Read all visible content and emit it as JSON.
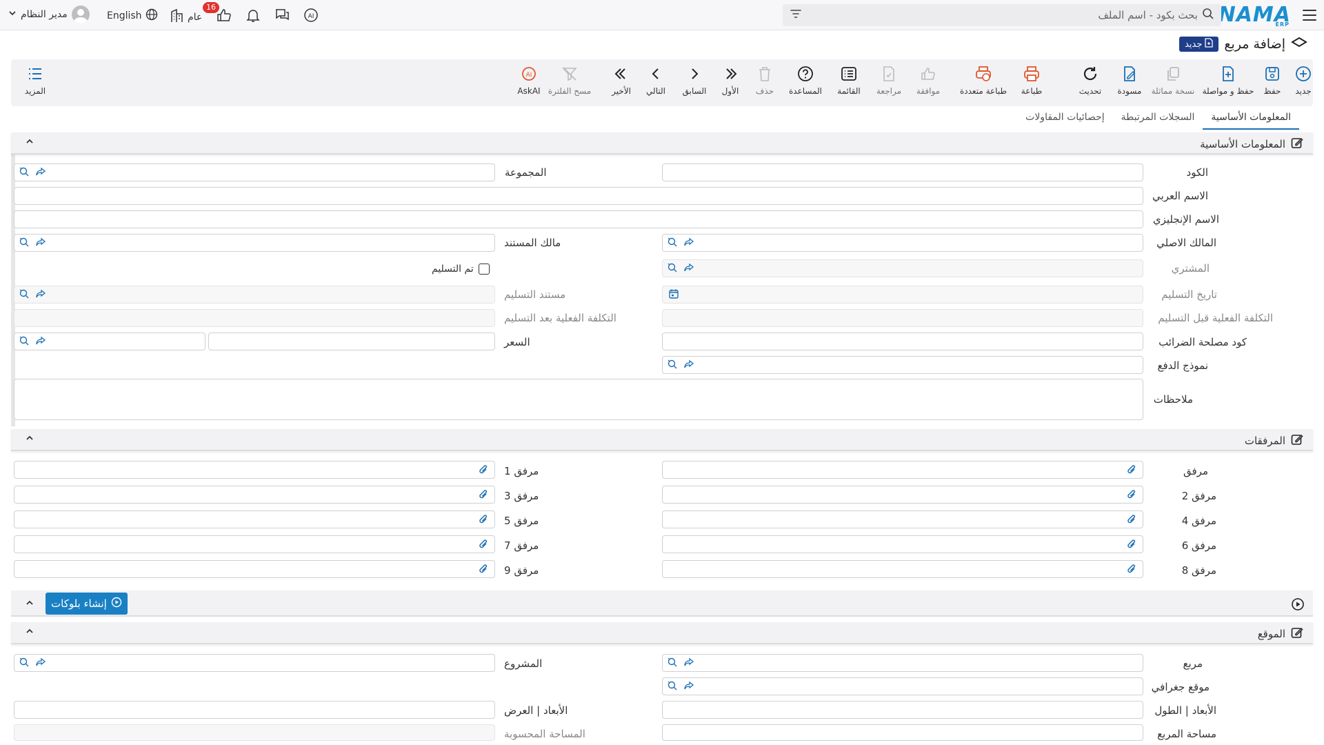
{
  "topbar": {
    "logo": "NAMA",
    "logo_sub": "ERP",
    "search_placeholder": "بحث بكود - اسم الملف",
    "language": "English",
    "general_label": "عام",
    "notif_count": "16",
    "user_name": "مدير النظام"
  },
  "page": {
    "title": "إضافة مربع",
    "new_badge": "جديد"
  },
  "toolbar": [
    {
      "label": "جديد",
      "icon": "plus-circle-icon"
    },
    {
      "label": "حفظ",
      "icon": "save-icon"
    },
    {
      "label": "حفظ و مواصلة",
      "icon": "save-continue-icon"
    },
    {
      "label": "نسخة مماثلة",
      "icon": "copy-icon"
    },
    {
      "label": "مسودة",
      "icon": "draft-icon"
    },
    {
      "label": "تحديث",
      "icon": "refresh-icon"
    },
    {
      "label": "طباعة",
      "icon": "print-icon"
    },
    {
      "label": "طباعة متعددة",
      "icon": "multi-print-icon"
    },
    {
      "label": "موافقة",
      "icon": "thumbs-up-icon"
    },
    {
      "label": "مراجعة",
      "icon": "review-icon"
    },
    {
      "label": "القائمة",
      "icon": "list-icon"
    },
    {
      "label": "المساعدة",
      "icon": "help-icon"
    },
    {
      "label": "حذف",
      "icon": "trash-icon"
    },
    {
      "label": "الأول",
      "icon": "first-icon"
    },
    {
      "label": "السابق",
      "icon": "prev-icon"
    },
    {
      "label": "التالي",
      "icon": "next-icon"
    },
    {
      "label": "الأخير",
      "icon": "last-icon"
    },
    {
      "label": "مسح الفلترة",
      "icon": "clear-filter-icon"
    },
    {
      "label": "AskAI",
      "icon": "ai-icon"
    },
    {
      "label": "المزيد",
      "icon": "more-icon"
    }
  ],
  "tabs": [
    "المعلومات الأساسية",
    "السجلات المرتبطة",
    "إحصائيات المقاولات"
  ],
  "sections": {
    "basic": "المعلومات الأساسية",
    "attachments": "المرفقات",
    "blocks_button": "إنشاء بلوكات",
    "location": "الموقع"
  },
  "basic_fields": {
    "code": "الكود",
    "group": "المجموعة",
    "arabic_name": "الاسم العربي",
    "english_name": "الاسم الإنجليزي",
    "original_owner": "المالك الاصلي",
    "document_owner": "مالك المستند",
    "buyer": "المشتري",
    "delivered": "تم التسليم",
    "delivery_date": "تاريخ التسليم",
    "delivery_document": "مستند التسليم",
    "cost_before": "التكلفة الفعلية قبل التسليم",
    "cost_after": "التكلفة الفعلية بعد التسليم",
    "tax_code": "كود مصلحة الضرائب",
    "price": "السعر",
    "payment_model": "نموذج الدفع",
    "notes": "ملاحظات"
  },
  "attachments": [
    "مرفق",
    "مرفق 1",
    "مرفق 2",
    "مرفق 3",
    "مرفق 4",
    "مرفق 5",
    "مرفق 6",
    "مرفق 7",
    "مرفق 8",
    "مرفق 9"
  ],
  "location_fields": {
    "block": "مربع",
    "project": "المشروع",
    "geo_location": "موقع جغرافي",
    "dim_length": "الأبعاد | الطول",
    "dim_width": "الأبعاد | العرض",
    "block_area": "مساحة المربع",
    "calc_area": "المساحة المحسوبة"
  },
  "colors": {
    "accent": "#1b6fb3",
    "brand": "#1b8fd0",
    "print": "#e0572a",
    "button": "#1a80c4"
  }
}
